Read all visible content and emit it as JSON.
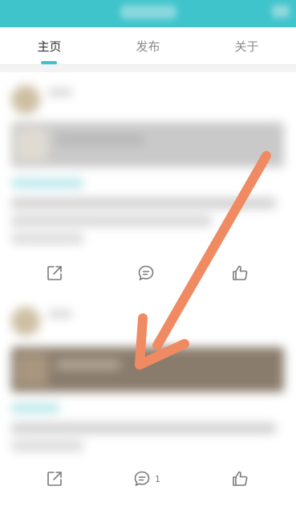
{
  "tabs": [
    {
      "label": "主页",
      "active": true
    },
    {
      "label": "发布",
      "active": false
    },
    {
      "label": "关于",
      "active": false
    }
  ],
  "colors": {
    "accent": "#40c4cc",
    "arrow": "#f08a62"
  },
  "posts": [
    {
      "actions": {
        "share_icon": "share-icon",
        "comment_icon": "comment-icon",
        "like_icon": "like-icon",
        "comment_count": ""
      }
    },
    {
      "actions": {
        "share_icon": "share-icon",
        "comment_icon": "comment-icon",
        "like_icon": "like-icon",
        "comment_count": "1"
      }
    }
  ]
}
